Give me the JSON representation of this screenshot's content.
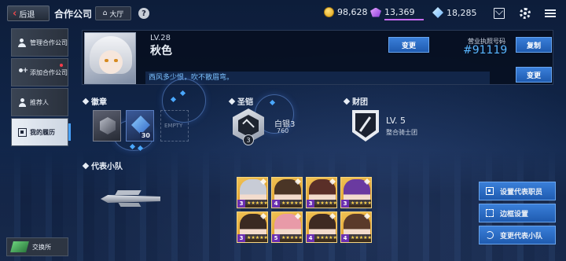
{
  "topbar": {
    "back_label": "后退",
    "title": "合作公司",
    "hall_label": "大厅",
    "help_symbol": "?",
    "coins": "98,628",
    "crystals_purple": "13,369",
    "crystals_blue": "18,285"
  },
  "sidebar": {
    "items": [
      {
        "label": "管理合作公司",
        "icon": "users-icon",
        "badge": false
      },
      {
        "label": "添加合作公司",
        "icon": "add-user-icon",
        "badge": true
      },
      {
        "label": "推荐人",
        "icon": "referral-icon",
        "badge": false
      },
      {
        "label": "我的履历",
        "icon": "resume-icon",
        "badge": false,
        "active": true
      }
    ],
    "exchange_label": "交换所"
  },
  "profile": {
    "level": "LV.28",
    "name": "秋色",
    "motto": "西风多少恨，吹不散眉弯。",
    "change_name_label": "变更",
    "license_label": "营业执照号码",
    "license_number": "#91119",
    "copy_label": "复制",
    "change_motto_label": "变更"
  },
  "sections": {
    "badges_title": "徽章",
    "armor_title": "圣铠",
    "guild_title": "财团",
    "team_title": "代表小队"
  },
  "badges": {
    "badge2_value": "30",
    "empty_label": "EMPTY"
  },
  "armor": {
    "level": "3",
    "rank": "白银3",
    "score": "760"
  },
  "guild": {
    "level": "LV. 5",
    "name": "整合骑士团"
  },
  "team": {
    "members": [
      {
        "rank": "3",
        "stars": "★★★★★★",
        "color": "#c8ccd6"
      },
      {
        "rank": "4",
        "stars": "★★★★★★",
        "color": "#4a3526"
      },
      {
        "rank": "3",
        "stars": "★★★★★★",
        "color": "#5a2f28"
      },
      {
        "rank": "3",
        "stars": "★★★★★★",
        "color": "#6a3aa0"
      },
      {
        "rank": "3",
        "stars": "★★★★★★",
        "color": "#3a2a22"
      },
      {
        "rank": "5",
        "stars": "★★★★★★",
        "color": "#e89aa8"
      },
      {
        "rank": "4",
        "stars": "★★★★★★",
        "color": "#3e2a22"
      },
      {
        "rank": "4",
        "stars": "★★★★★★",
        "color": "#5a3a2a"
      }
    ]
  },
  "actions": {
    "set_rep_label": "设置代表职员",
    "frame_label": "边框设置",
    "change_team_label": "变更代表小队"
  }
}
